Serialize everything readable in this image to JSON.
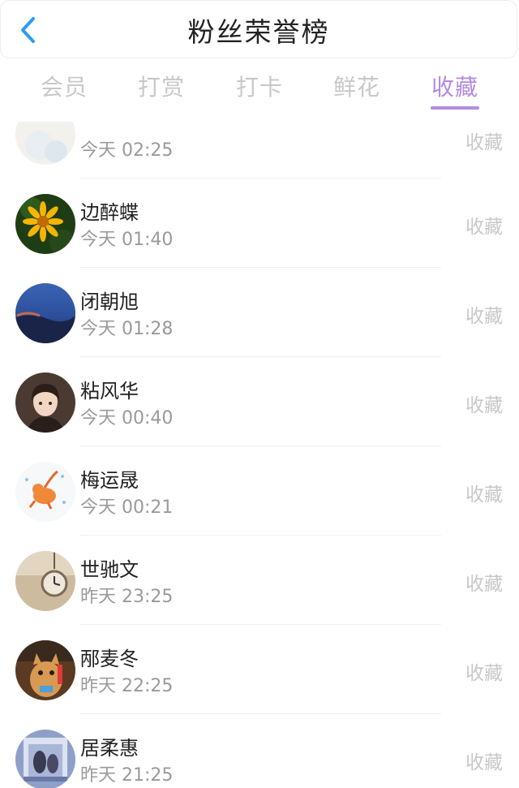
{
  "header": {
    "title": "粉丝荣誉榜",
    "back_icon": "chevron-left-icon",
    "back_color": "#2f9bf0"
  },
  "tabs": [
    {
      "label": "会员",
      "active": false
    },
    {
      "label": "打赏",
      "active": false
    },
    {
      "label": "打卡",
      "active": false
    },
    {
      "label": "鲜花",
      "active": false
    },
    {
      "label": "收藏",
      "active": true
    }
  ],
  "accent_color": "#b38be0",
  "list": {
    "items": [
      {
        "name": "",
        "time": "今天 02:25",
        "action": "收藏"
      },
      {
        "name": "边醉蝶",
        "time": "今天 01:40",
        "action": "收藏"
      },
      {
        "name": "闭朝旭",
        "time": "今天 01:28",
        "action": "收藏"
      },
      {
        "name": "粘风华",
        "time": "今天 00:40",
        "action": "收藏"
      },
      {
        "name": "梅运晟",
        "time": "今天 00:21",
        "action": "收藏"
      },
      {
        "name": "世驰文",
        "time": "昨天 23:25",
        "action": "收藏"
      },
      {
        "name": "邴麦冬",
        "time": "昨天 22:25",
        "action": "收藏"
      },
      {
        "name": "居柔惠",
        "time": "昨天 21:25",
        "action": "收藏"
      }
    ]
  }
}
